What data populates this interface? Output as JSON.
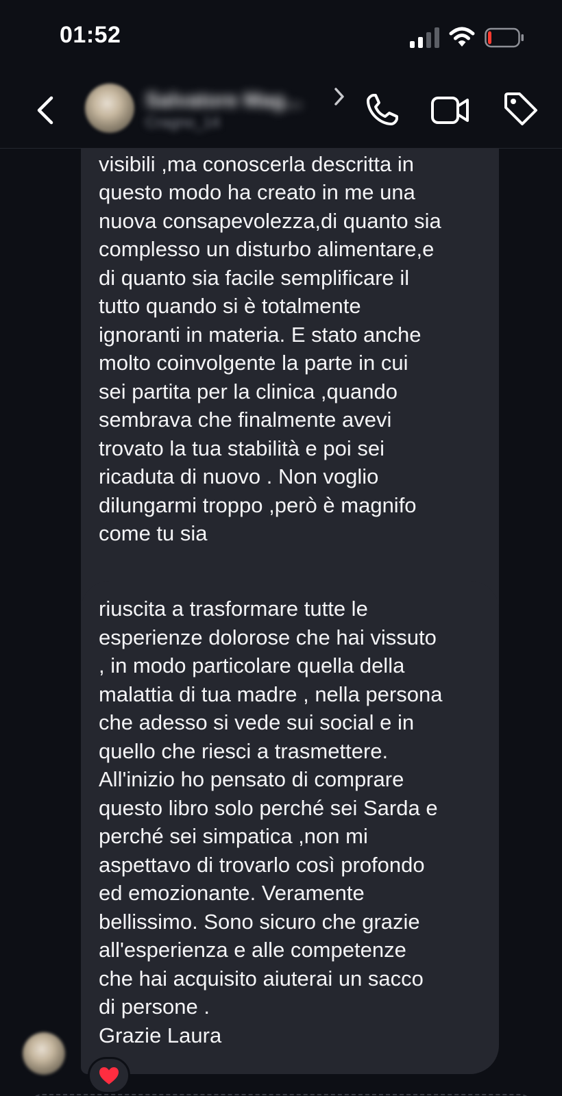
{
  "status_bar": {
    "time": "01:52",
    "signal_icon": "cellular-signal-icon",
    "wifi_icon": "wifi-icon",
    "battery_icon": "battery-low-icon",
    "battery_level": 0.12,
    "battery_color": "#ff3b30"
  },
  "header": {
    "back_icon": "chevron-left-icon",
    "contact_name": "Salvatore Mag...",
    "contact_subtitle": "Cragno_14",
    "call_icon": "phone-icon",
    "video_icon": "video-camera-icon",
    "tag_icon": "tag-icon"
  },
  "messages": [
    {
      "text": "l'anoressia ,quali sono i suoi effetti\nvisibili ,ma conoscerla descritta in\nquesto modo ha creato in me una\nnuova consapevolezza,di quanto sia\ncomplesso un disturbo alimentare,e\ndi quanto sia facile semplificare il\ntutto quando si è totalmente\nignoranti in materia. E stato anche\nmolto coinvolgente la parte in cui\nsei partita per la clinica ,quando\nsembrava che finalmente avevi\ntrovato la tua stabilità e poi sei\nricaduta di nuovo . Non voglio\ndilungarmi troppo ,però è magnifo\ncome tu sia"
    },
    {
      "text": "riuscita a trasformare tutte le\nesperienze dolorose che hai vissuto\n, in  modo particolare quella della\nmalattia di tua madre , nella persona\nche adesso si vede sui social e in\nquello che riesci a trasmettere.\nAll'inizio ho pensato di comprare\nquesto libro solo perché sei Sarda e\nperché sei simpatica ,non mi\naspettavo di trovarlo così profondo\ned emozionante. Veramente\nbellissimo. Sono sicuro che grazie\nall'esperienza e alle competenze\nche hai acquisito aiuterai un sacco\ndi persone .\nGrazie Laura",
      "reaction": "heart-icon",
      "reaction_color": "#ff2d40"
    }
  ],
  "colors": {
    "background": "#0d0f15",
    "bubble": "#25272f",
    "text": "#f4f4f6"
  }
}
